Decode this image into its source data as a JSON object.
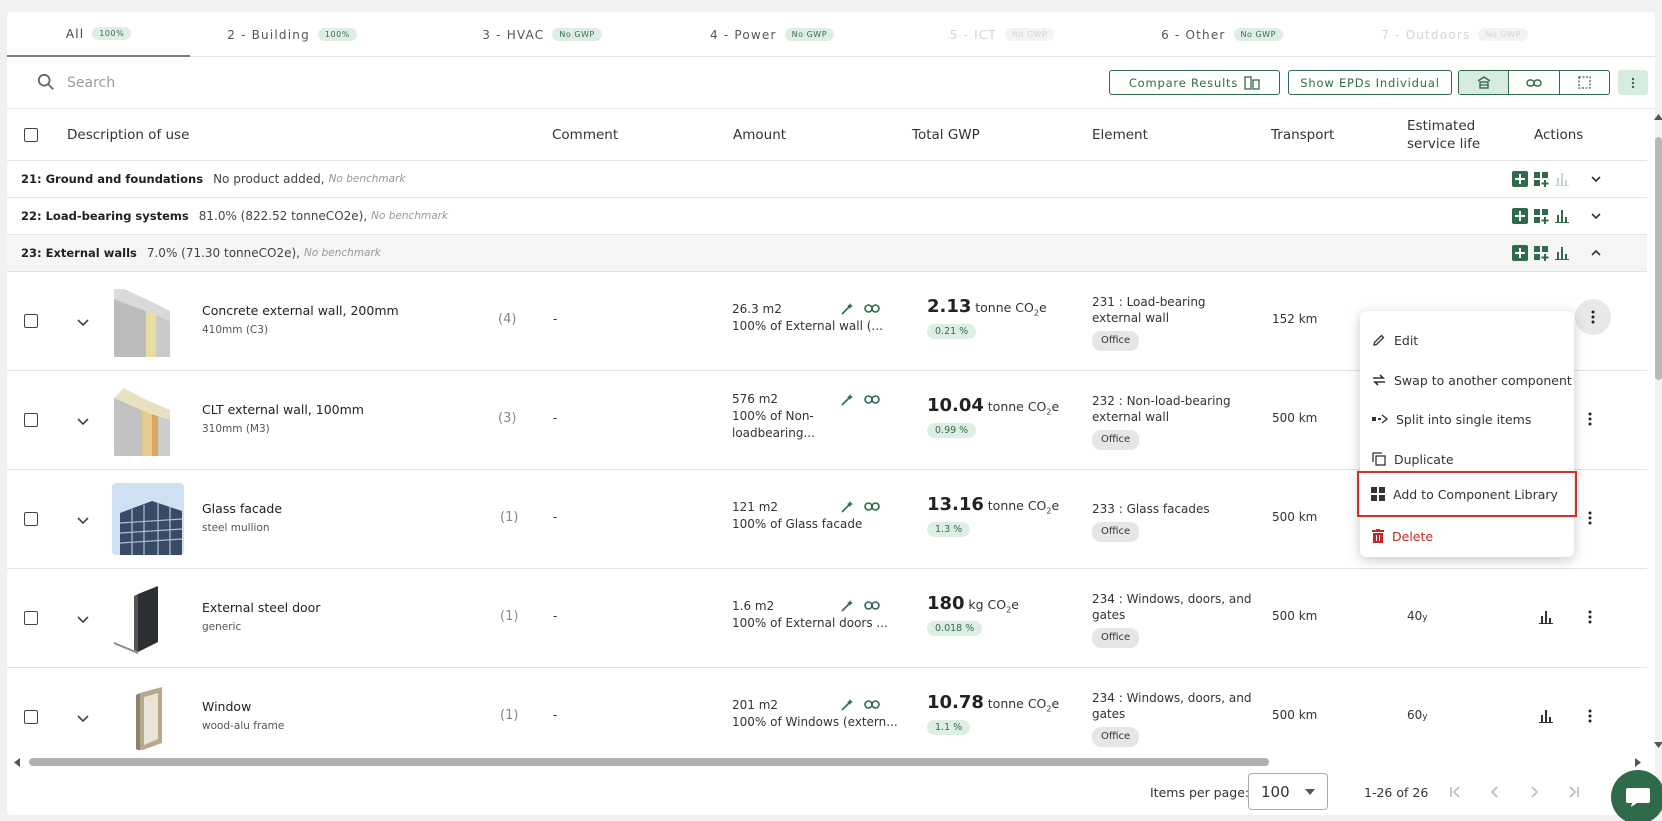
{
  "tabs": [
    {
      "label": "All",
      "badge": "100%"
    },
    {
      "label": "2 - Building",
      "badge": "100%"
    },
    {
      "label": "3 - HVAC",
      "badge": "No GWP"
    },
    {
      "label": "4 - Power",
      "badge": "No GWP"
    },
    {
      "label": "5 - ICT",
      "badge": "No GWP"
    },
    {
      "label": "6 - Other",
      "badge": "No GWP"
    },
    {
      "label": "7 - Outdoors",
      "badge": "No GWP"
    }
  ],
  "search": {
    "placeholder": "Search"
  },
  "toolbar": {
    "compare_label": "Compare Results",
    "show_epds_label": "Show EPDs Individual"
  },
  "columns": {
    "description": "Description of use",
    "comment": "Comment",
    "amount": "Amount",
    "total_gwp": "Total GWP",
    "element": "Element",
    "transport": "Transport",
    "esl_1": "Estimated",
    "esl_2": "service life",
    "actions": "Actions"
  },
  "groups": [
    {
      "title": "21: Ground and foundations",
      "info": "No product added,",
      "benchmark": "No benchmark"
    },
    {
      "title": "22: Load-bearing systems",
      "info": "81.0% (822.52 tonneCO2e),",
      "benchmark": "No benchmark"
    },
    {
      "title": "23: External walls",
      "info": "7.0% (71.30 tonneCO2e),",
      "benchmark": "No benchmark"
    }
  ],
  "rows": [
    {
      "name": "Concrete external wall, 200mm",
      "sub": "410mm (C3)",
      "count": "(4)",
      "comment": "-",
      "amount_1": "26.3 m2",
      "amount_2": "100% of External wall (...",
      "amount_3": "",
      "gwp": "2.13",
      "gwp_unit": "tonne CO",
      "gwp_unit_sub": "2",
      "gwp_unit_end": "e",
      "pct": "0.21 %",
      "element_1": "231 : Load-bearing",
      "element_2": "external wall",
      "tag": "Office",
      "transport": "152 km",
      "esl": "",
      "esl_unit": ""
    },
    {
      "name": "CLT external wall, 100mm",
      "sub": "310mm (M3)",
      "count": "(3)",
      "comment": "-",
      "amount_1": "576 m2",
      "amount_2": "100% of Non-",
      "amount_3": "loadbearing...",
      "gwp": "10.04",
      "gwp_unit": "tonne CO",
      "gwp_unit_sub": "2",
      "gwp_unit_end": "e",
      "pct": "0.99 %",
      "element_1": "232 : Non-load-bearing",
      "element_2": "external wall",
      "tag": "Office",
      "transport": "500 km",
      "esl": "",
      "esl_unit": ""
    },
    {
      "name": "Glass facade",
      "sub": "steel mullion",
      "count": "(1)",
      "comment": "-",
      "amount_1": "121 m2",
      "amount_2": "100% of Glass facade",
      "amount_3": "",
      "gwp": "13.16",
      "gwp_unit": "tonne CO",
      "gwp_unit_sub": "2",
      "gwp_unit_end": "e",
      "pct": "1.3 %",
      "element_1": "233 : Glass facades",
      "element_2": "",
      "tag": "Office",
      "transport": "500 km",
      "esl": "",
      "esl_unit": ""
    },
    {
      "name": "External steel door",
      "sub": "generic",
      "count": "(1)",
      "comment": "-",
      "amount_1": "1.6 m2",
      "amount_2": "100% of External doors ...",
      "amount_3": "",
      "gwp": "180",
      "gwp_unit": "kg CO",
      "gwp_unit_sub": "2",
      "gwp_unit_end": "e",
      "pct": "0.018 %",
      "element_1": "234 : Windows, doors, and",
      "element_2": "gates",
      "tag": "Office",
      "transport": "500 km",
      "esl": "40",
      "esl_unit": "y"
    },
    {
      "name": "Window",
      "sub": "wood-alu frame",
      "count": "(1)",
      "comment": "-",
      "amount_1": "201 m2",
      "amount_2": "100% of Windows (extern...",
      "amount_3": "",
      "gwp": "10.78",
      "gwp_unit": "tonne CO",
      "gwp_unit_sub": "2",
      "gwp_unit_end": "e",
      "pct": "1.1 %",
      "element_1": "234 : Windows, doors, and",
      "element_2": "gates",
      "tag": "Office",
      "transport": "500 km",
      "esl": "60",
      "esl_unit": "y"
    }
  ],
  "context_menu": {
    "edit": "Edit",
    "swap": "Swap to another component",
    "split": "Split into single items",
    "duplicate": "Duplicate",
    "add_library": "Add to Component Library",
    "delete": "Delete"
  },
  "footer": {
    "items_per_page_label": "Items per page:",
    "items_per_page": "100",
    "range": "1-26 of 26"
  },
  "colors": {
    "brand": "#2f6b4b",
    "badge_bg": "#dfeee5",
    "delete": "#c62828",
    "highlight": "#d32f2f"
  }
}
